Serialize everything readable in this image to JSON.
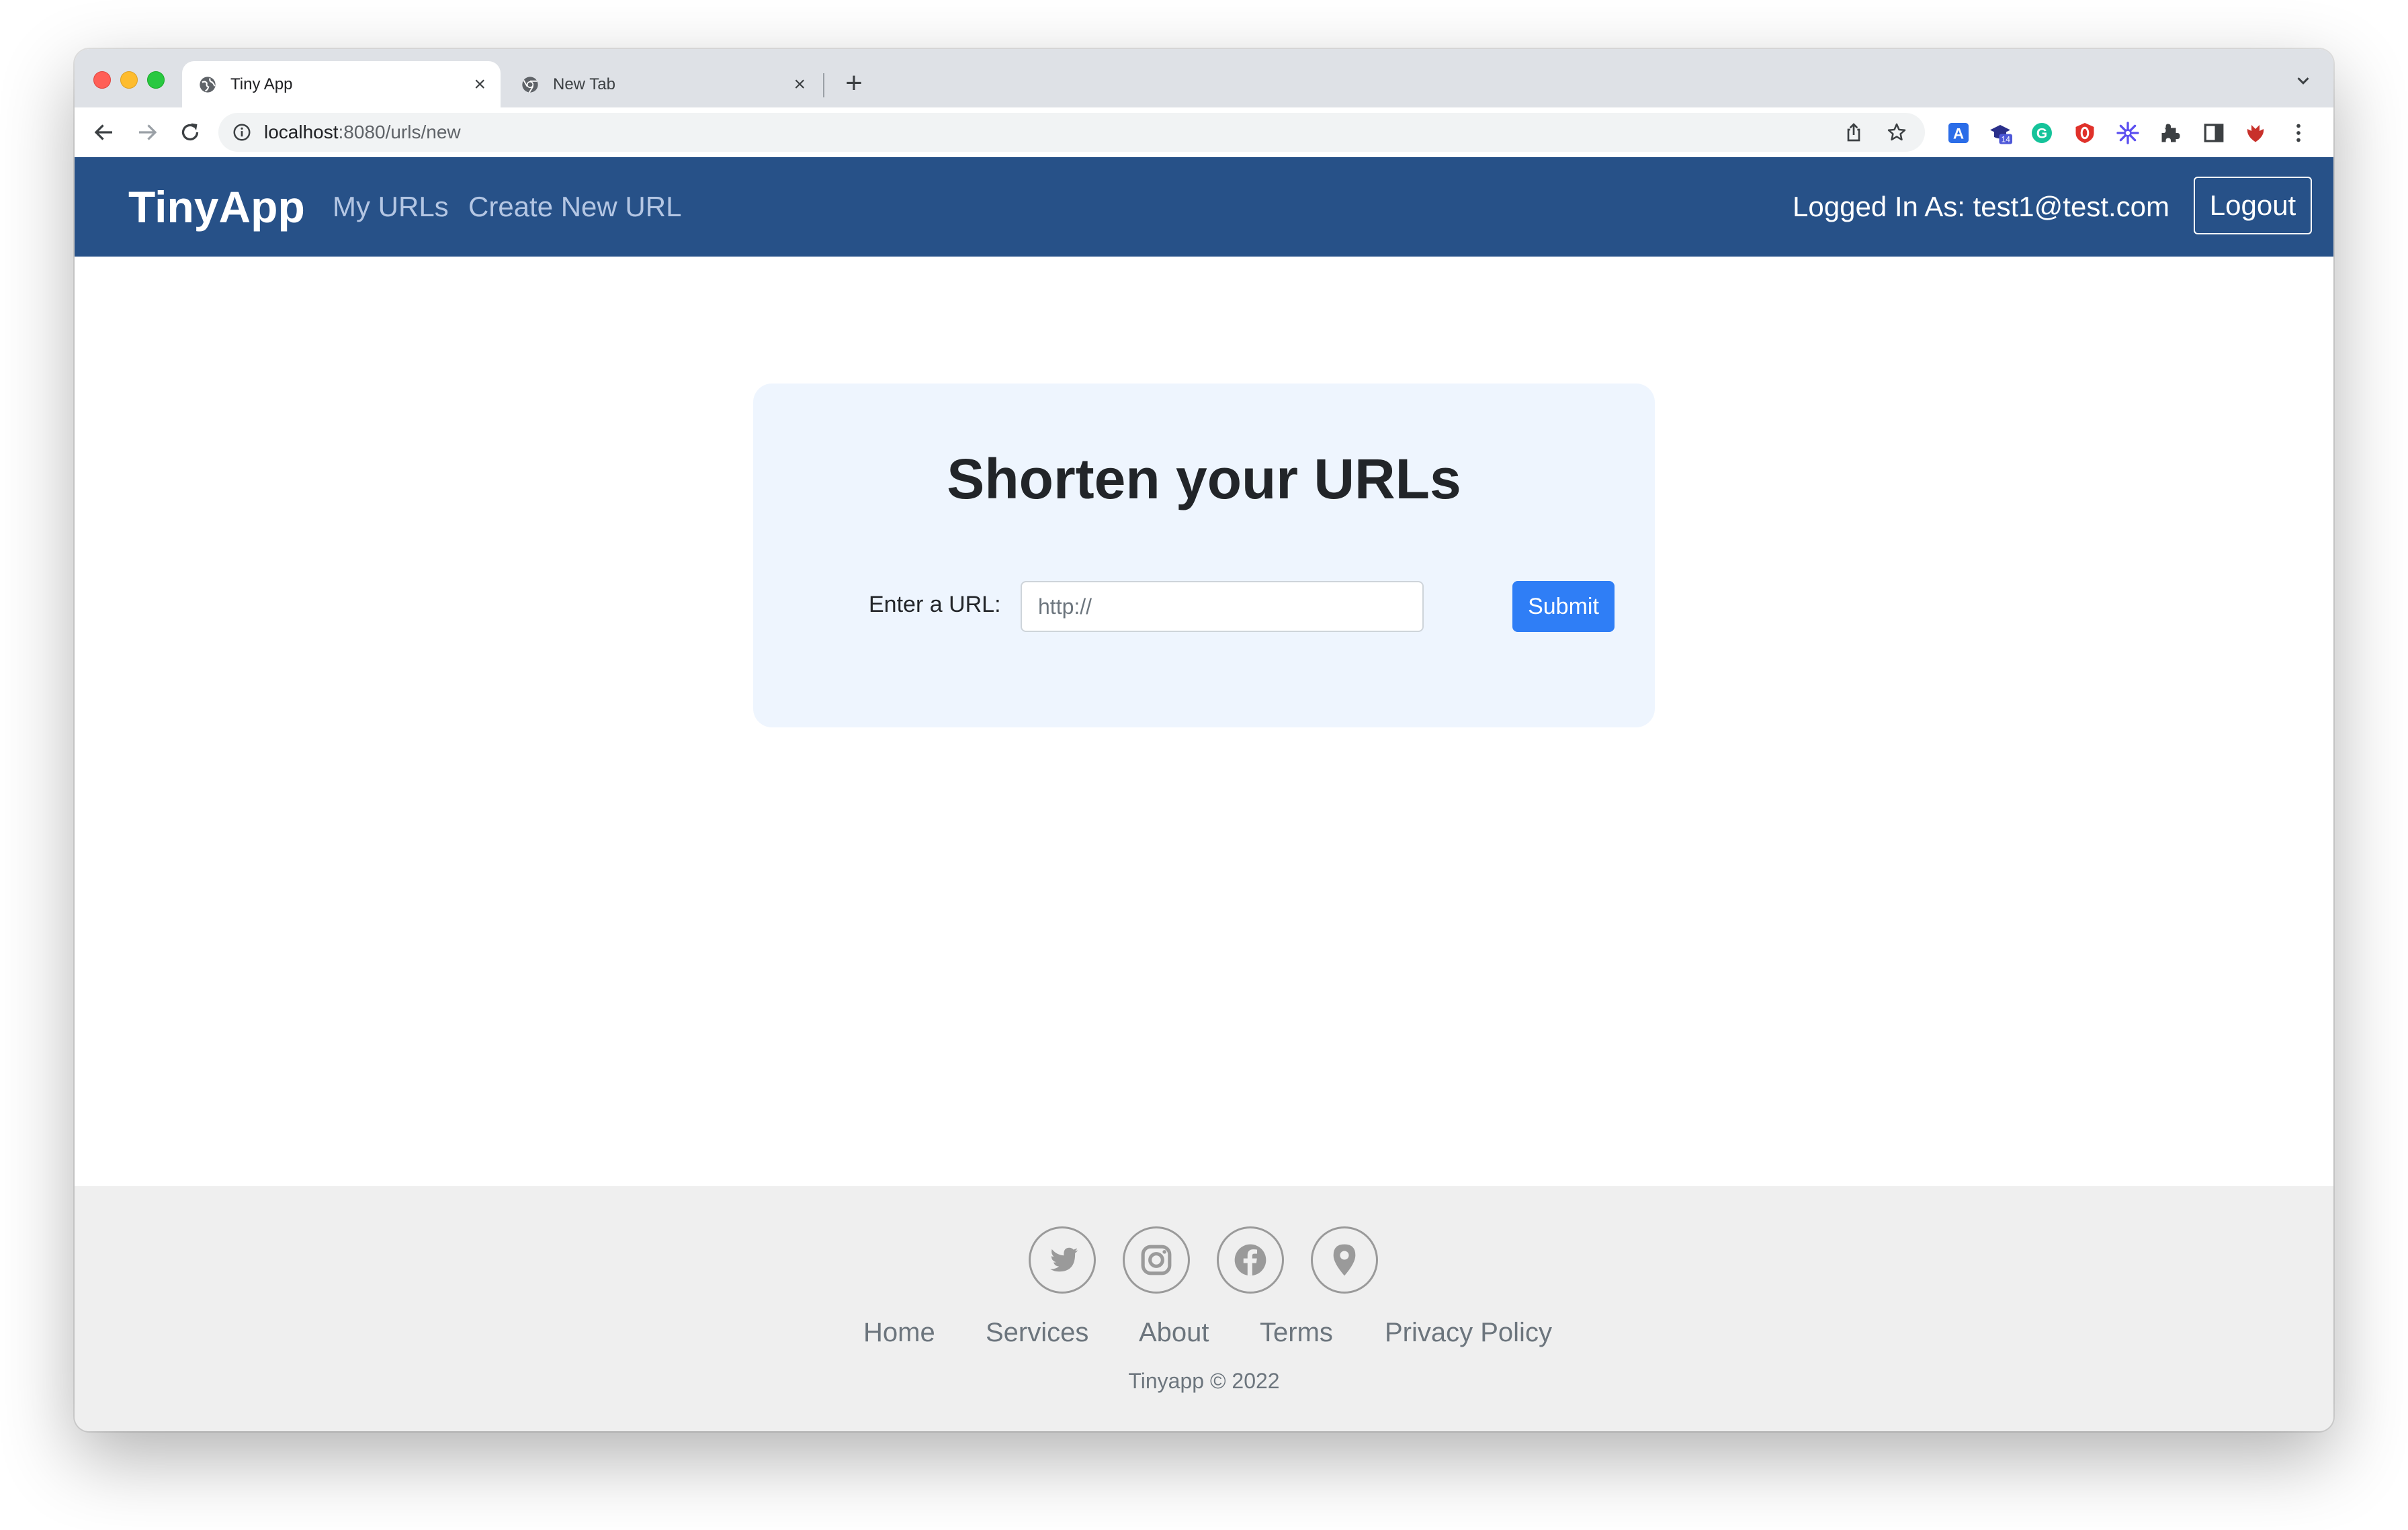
{
  "browser": {
    "tabs": [
      {
        "title": "Tiny App",
        "active": true
      },
      {
        "title": "New Tab",
        "active": false
      }
    ],
    "new_tab_symbol": "+",
    "close_symbol": "×",
    "address": {
      "host": "localhost",
      "rest": ":8080/urls/new"
    },
    "icons": [
      "back-icon",
      "forward-icon",
      "reload-icon",
      "site-info-icon",
      "share-icon",
      "bookmark-star-icon",
      "extension-translate-icon",
      "extension-badge-icon",
      "extension-grammarly-icon",
      "extension-shield-icon",
      "extension-snowflake-icon",
      "extensions-puzzle-icon",
      "side-panel-icon",
      "profile-icon",
      "menu-icon"
    ],
    "extension_badge_count": "14",
    "translate_letter": "A",
    "grammarly_letter": "G"
  },
  "navbar": {
    "brand": "TinyApp",
    "links": [
      "My URLs",
      "Create New URL"
    ],
    "logged_in_text": "Logged In As: test1@test.com",
    "logout_label": "Logout",
    "background": "#275188"
  },
  "main": {
    "heading": "Shorten your URLs",
    "url_label": "Enter a URL:",
    "url_placeholder": "http://",
    "submit_label": "Submit",
    "accent": "#2f7ef6"
  },
  "footer": {
    "social_icons": [
      "twitter-icon",
      "instagram-icon",
      "facebook-icon",
      "location-pin-icon"
    ],
    "links": [
      "Home",
      "Services",
      "About",
      "Terms",
      "Privacy Policy"
    ],
    "copyright": "Tinyapp © 2022"
  }
}
